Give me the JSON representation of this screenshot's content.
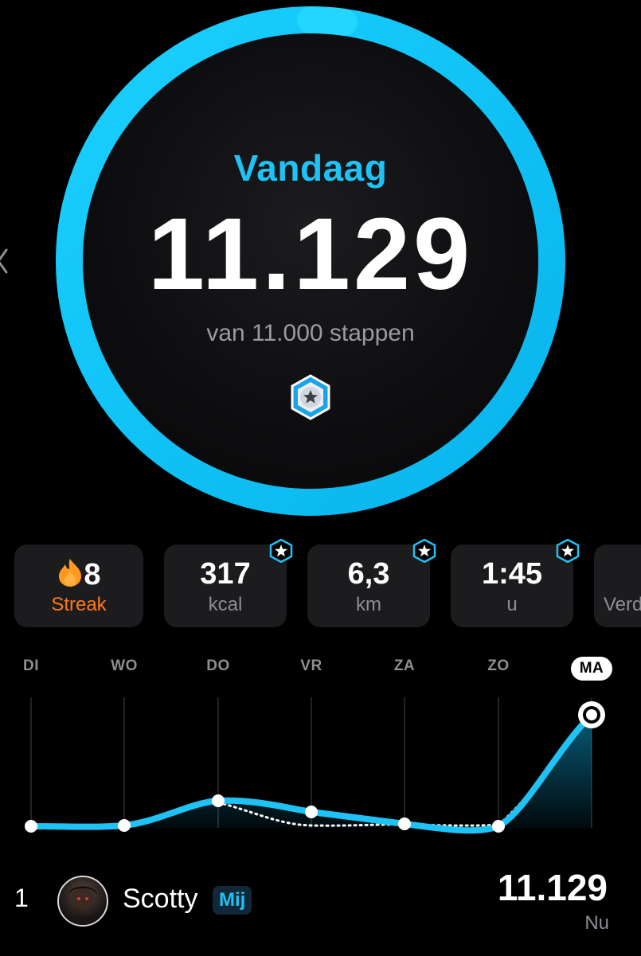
{
  "today": {
    "title": "Vandaag",
    "steps": "11.129",
    "goal_text": "van 11.000 stappen",
    "progress_fraction": 1.0
  },
  "stats": [
    {
      "value": "8",
      "label": "Streak"
    },
    {
      "value": "317",
      "label": "kcal"
    },
    {
      "value": "6,3",
      "label": "km"
    },
    {
      "value": "1:45",
      "label": "u"
    },
    {
      "value": "",
      "label": "Verd"
    }
  ],
  "week": {
    "days": [
      "DI",
      "WO",
      "DO",
      "VR",
      "ZA",
      "ZO",
      "MA"
    ],
    "active_day": "MA"
  },
  "leaderboard": {
    "rank": "1",
    "name": "Scotty",
    "me_label": "Mij",
    "steps": "11.129",
    "when": "Nu"
  },
  "colors": {
    "accent": "#1fc2f4",
    "streak": "#ff7a1a",
    "card": "#1c1c1e"
  }
}
